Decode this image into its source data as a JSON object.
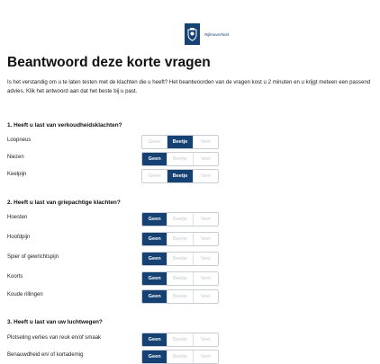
{
  "header": {
    "logo_text": "Rijksoverheid"
  },
  "title": "Beantwoord deze korte vragen",
  "intro": "Is het verstandig om u te laten testen met de klachten die u heeft? Het beantwoorden van de vragen kost u 2 minuten en u krijgt meteen een passend advies. Klik het antwoord aan dat het beste bij u past.",
  "options": {
    "none": "Geen",
    "little": "Beetje",
    "much": "Veel"
  },
  "colors": {
    "accent": "#154273",
    "option_border": "#c9ced6",
    "option_inactive_text": "#c5c9cf"
  },
  "questions": [
    {
      "heading": "1. Heeft u last van verkoudheidsklachten?",
      "items": [
        {
          "label": "Loopneus",
          "selected": "Beetje"
        },
        {
          "label": "Niezen",
          "selected": "Geen"
        },
        {
          "label": "Keelpijn",
          "selected": "Beetje"
        }
      ]
    },
    {
      "heading": "2. Heeft u last van griepachtige klachten?",
      "items": [
        {
          "label": "Hoesten",
          "selected": "Geen"
        },
        {
          "label": "Hoofdpijn",
          "selected": "Geen"
        },
        {
          "label": "Spier of gewrichtspijn",
          "selected": "Geen"
        },
        {
          "label": "Koorts",
          "selected": "Geen"
        },
        {
          "label": "Koude rillingen",
          "selected": "Geen"
        }
      ]
    },
    {
      "heading": "3. Heeft u last van uw luchtwegen?",
      "items": [
        {
          "label": "Plotseling verlies van reuk en/of smaak",
          "selected": "Geen"
        },
        {
          "label": "Benauwdheid en/ of kortademig",
          "selected": "Geen"
        }
      ]
    }
  ]
}
